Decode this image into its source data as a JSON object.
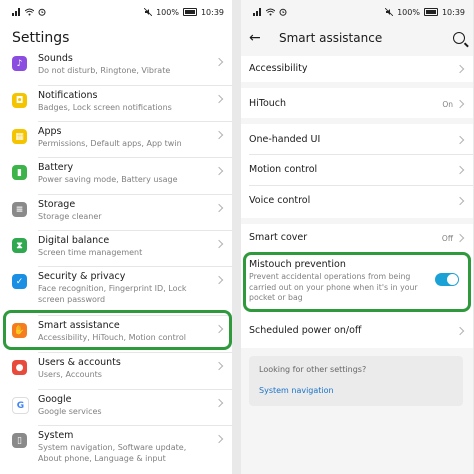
{
  "status": {
    "battery": "100%",
    "time": "10:39"
  },
  "left": {
    "title": "Settings",
    "items": [
      {
        "label": "Sounds",
        "sub": "Do not disturb, Ringtone, Vibrate",
        "icon": "music-note-icon",
        "color": "#8a4de0"
      },
      {
        "label": "Notifications",
        "sub": "Badges, Lock screen notifications",
        "icon": "bell-icon",
        "color": "#f5c400"
      },
      {
        "label": "Apps",
        "sub": "Permissions, Default apps, App twin",
        "icon": "apps-grid-icon",
        "color": "#f5c400"
      },
      {
        "label": "Battery",
        "sub": "Power saving mode, Battery usage",
        "icon": "battery-icon",
        "color": "#3cb44a"
      },
      {
        "label": "Storage",
        "sub": "Storage cleaner",
        "icon": "storage-icon",
        "color": "#8a8a8a"
      },
      {
        "label": "Digital balance",
        "sub": "Screen time management",
        "icon": "hourglass-icon",
        "color": "#2fa84f"
      },
      {
        "label": "Security & privacy",
        "sub": "Face recognition, Fingerprint ID, Lock screen password",
        "icon": "shield-icon",
        "color": "#1a8fe3"
      },
      {
        "label": "Smart assistance",
        "sub": "Accessibility, HiTouch, Motion control",
        "icon": "hand-icon",
        "color": "#f57c1f"
      },
      {
        "label": "Users & accounts",
        "sub": "Users, Accounts",
        "icon": "user-icon",
        "color": "#e84b3c"
      },
      {
        "label": "Google",
        "sub": "Google services",
        "icon": "google-icon",
        "color": "#ffffff"
      },
      {
        "label": "System",
        "sub": "System navigation, Software update, About phone, Language & input",
        "icon": "phone-icon",
        "color": "#8a8a8a"
      }
    ]
  },
  "right": {
    "title": "Smart assistance",
    "items": [
      {
        "label": "Accessibility"
      },
      {
        "label": "HiTouch",
        "value": "On"
      },
      {
        "label": "One-handed UI"
      },
      {
        "label": "Motion control"
      },
      {
        "label": "Voice control"
      },
      {
        "label": "Smart cover",
        "value": "Off"
      }
    ],
    "mistouch": {
      "label": "Mistouch prevention",
      "desc": "Prevent accidental operations from being carried out on your phone when it's in your pocket or bag"
    },
    "scheduled": {
      "label": "Scheduled power on/off"
    },
    "tip": {
      "question": "Looking for other settings?",
      "link": "System navigation"
    }
  },
  "highlight_color": "#2e9a3c",
  "accent_color": "#1aa2d6"
}
